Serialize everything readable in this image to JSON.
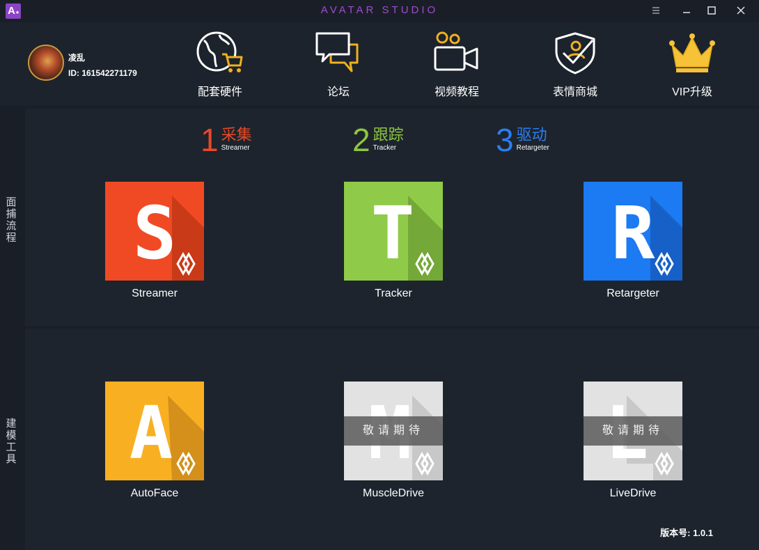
{
  "window": {
    "title": "AVATAR STUDIO",
    "logo_letter": "A",
    "menu_icon": "menu-icon",
    "minimize_icon": "minimize-icon",
    "maximize_icon": "maximize-icon",
    "close_icon": "close-icon"
  },
  "user": {
    "name": "凌乱",
    "id_label": "ID: 161542271179"
  },
  "nav": [
    {
      "label": "配套硬件",
      "icon": "globe-cart-icon"
    },
    {
      "label": "论坛",
      "icon": "chat-bubbles-icon"
    },
    {
      "label": "视频教程",
      "icon": "video-camera-icon"
    },
    {
      "label": "表情商城",
      "icon": "shield-user-icon"
    },
    {
      "label": "VIP升级",
      "icon": "crown-icon"
    }
  ],
  "rail": {
    "capture_flow": "面捕流程",
    "modeling_tools": "建模工具"
  },
  "steps": [
    {
      "num": "1",
      "cn": "采集",
      "en": "Streamer",
      "color": "#e84a26"
    },
    {
      "num": "2",
      "cn": "跟踪",
      "en": "Tracker",
      "color": "#8dc63f"
    },
    {
      "num": "3",
      "cn": "驱动",
      "en": "Retargeter",
      "color": "#2a7ff0"
    }
  ],
  "flow_apps": [
    {
      "label": "Streamer",
      "letter": "S",
      "bg": "#f04a24",
      "shadow": "#c93a18"
    },
    {
      "label": "Tracker",
      "letter": "T",
      "bg": "#8fcb48",
      "shadow": "#74a838"
    },
    {
      "label": "Retargeter",
      "letter": "R",
      "bg": "#1c7af2",
      "shadow": "#1660c8"
    }
  ],
  "tool_apps": [
    {
      "label": "AutoFace",
      "letter": "A",
      "bg": "#f8b022",
      "shadow": "#d4901a"
    },
    {
      "label": "MuscleDrive",
      "letter": "M",
      "bg": "#e2e2e2",
      "shadow": "#c8c8c8",
      "badge": "敬请期待"
    },
    {
      "label": "LiveDrive",
      "letter": "L",
      "bg": "#e2e2e2",
      "shadow": "#c8c8c8",
      "badge": "敬请期待"
    }
  ],
  "version": "版本号: 1.0.1"
}
